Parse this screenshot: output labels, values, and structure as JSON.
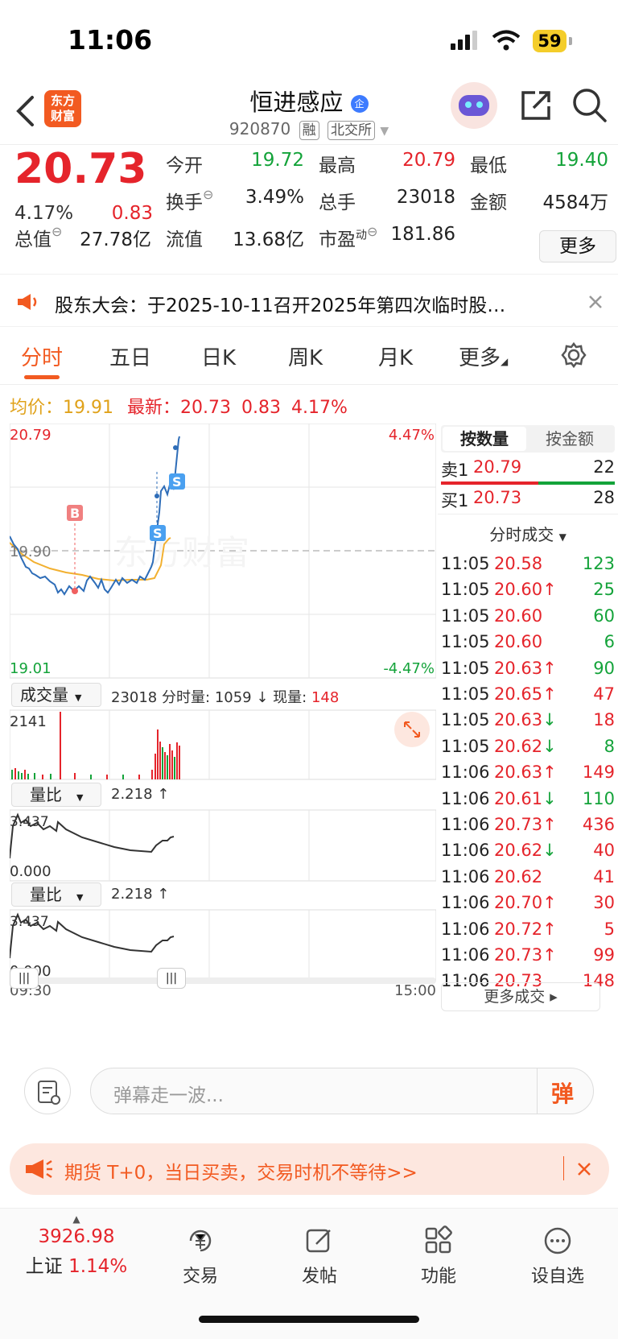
{
  "status_bar": {
    "time": "11:06",
    "battery": "59"
  },
  "header": {
    "name": "恒进感应",
    "name_badge": "企",
    "code": "920870",
    "tag_margin": "融",
    "exchange": "北交所",
    "logo_line1": "东方",
    "logo_line2": "财富"
  },
  "quote": {
    "price": "20.73",
    "change_pct": "4.17%",
    "change": "0.83",
    "open_label": "今开",
    "open": "19.72",
    "high_label": "最高",
    "high": "20.79",
    "low_label": "最低",
    "low": "19.40",
    "turnover_label": "换手",
    "turnover": "3.49%",
    "volume_label": "总手",
    "volume": "23018",
    "amount_label": "金额",
    "amount": "4584万",
    "mcap_label": "总值",
    "mcap": "27.78亿",
    "float_label": "流值",
    "float_mcap": "13.68亿",
    "pe_label": "市盈",
    "pe_sup": "动",
    "pe": "181.86",
    "more": "更多"
  },
  "notice": {
    "text": "股东大会：于2025-10-11召开2025年第四次临时股…"
  },
  "tabs": {
    "t1": "分时",
    "t2": "五日",
    "t3": "日K",
    "t4": "周K",
    "t5": "月K",
    "t6": "更多"
  },
  "avg_line": {
    "avg_label": "均价：",
    "avg": "19.91",
    "latest_label": "最新：",
    "latest": "20.73",
    "chg": "0.83",
    "pct": "4.17%"
  },
  "chart": {
    "y_top": "20.79",
    "y_mid": "19.90",
    "y_bot": "19.01",
    "pct_top": "4.47%",
    "pct_bot": "-4.47%",
    "watermark": "东方财富",
    "buy_marker": "B",
    "sell_marker": "S",
    "vol_selector": "成交量",
    "vol_total": "23018",
    "vol_minute_label": "分时量:",
    "vol_minute": "1059",
    "vol_now_label": "现量:",
    "vol_now": "148",
    "vol_max": "2141",
    "ratio_selector": "量比",
    "ratio_value": "2.218",
    "ratio_top": "3.437",
    "ratio_bot": "0.000",
    "time_start": "09:30",
    "time_end": "15:00"
  },
  "orderbook": {
    "tab_volume": "按数量",
    "tab_amount": "按金额",
    "ask1_label": "卖1",
    "ask1_price": "20.79",
    "ask1_vol": "22",
    "bid1_label": "买1",
    "bid1_price": "20.73",
    "bid1_vol": "28",
    "trades_header": "分时成交",
    "trades": [
      {
        "t": "11:05",
        "p": "20.58",
        "v": "123",
        "a": "",
        "vc": "green"
      },
      {
        "t": "11:05",
        "p": "20.60",
        "v": "25",
        "a": "↑",
        "vc": "green"
      },
      {
        "t": "11:05",
        "p": "20.60",
        "v": "60",
        "a": "",
        "vc": "green"
      },
      {
        "t": "11:05",
        "p": "20.60",
        "v": "6",
        "a": "",
        "vc": "green"
      },
      {
        "t": "11:05",
        "p": "20.63",
        "v": "90",
        "a": "↑",
        "vc": "green"
      },
      {
        "t": "11:05",
        "p": "20.65",
        "v": "47",
        "a": "↑",
        "vc": "red"
      },
      {
        "t": "11:05",
        "p": "20.63",
        "v": "18",
        "a": "↓",
        "vc": "red"
      },
      {
        "t": "11:05",
        "p": "20.62",
        "v": "8",
        "a": "↓",
        "vc": "green"
      },
      {
        "t": "11:06",
        "p": "20.63",
        "v": "149",
        "a": "↑",
        "vc": "red"
      },
      {
        "t": "11:06",
        "p": "20.61",
        "v": "110",
        "a": "↓",
        "vc": "green"
      },
      {
        "t": "11:06",
        "p": "20.73",
        "v": "436",
        "a": "↑",
        "vc": "red"
      },
      {
        "t": "11:06",
        "p": "20.62",
        "v": "40",
        "a": "↓",
        "vc": "red"
      },
      {
        "t": "11:06",
        "p": "20.62",
        "v": "41",
        "a": "",
        "vc": "red"
      },
      {
        "t": "11:06",
        "p": "20.70",
        "v": "30",
        "a": "↑",
        "vc": "red"
      },
      {
        "t": "11:06",
        "p": "20.72",
        "v": "5",
        "a": "↑",
        "vc": "red"
      },
      {
        "t": "11:06",
        "p": "20.73",
        "v": "99",
        "a": "↑",
        "vc": "red"
      },
      {
        "t": "11:06",
        "p": "20.73",
        "v": "148",
        "a": "",
        "vc": "red"
      }
    ],
    "more_trades": "更多成交"
  },
  "danmu": {
    "placeholder": "弹幕走一波...",
    "send": "弹"
  },
  "promo": {
    "text": "期货 T+0，当日买卖，交易时机不等待>>"
  },
  "bottom_nav": {
    "index_value": "3926.98",
    "index_name": "上证",
    "index_pct": "1.14%",
    "trade": "交易",
    "post": "发帖",
    "func": "功能",
    "watch": "设自选"
  }
}
